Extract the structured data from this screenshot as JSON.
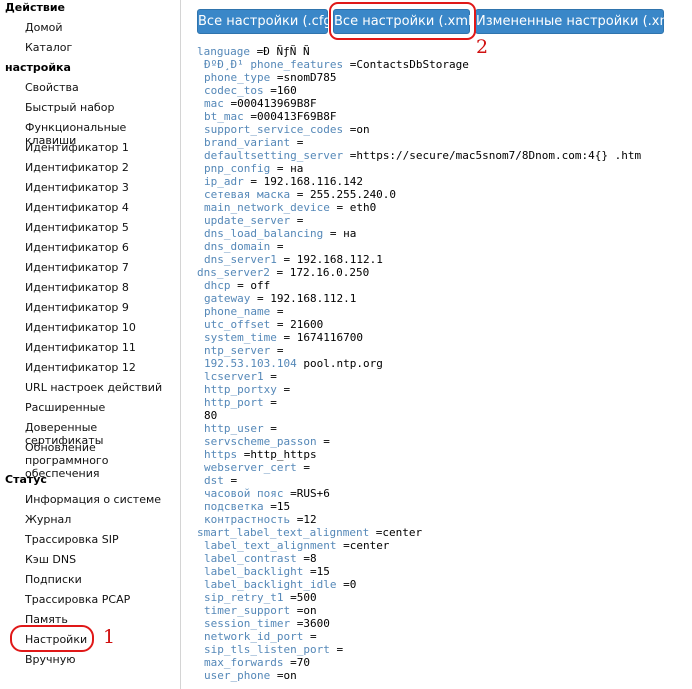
{
  "sidebar": {
    "sections": [
      {
        "title": "Действие",
        "items": [
          "Домой",
          "Каталог"
        ]
      },
      {
        "title": "настройка",
        "items": [
          "Свойства",
          "Быстрый набор",
          "Функциональные клавиши",
          "Идентификатор 1",
          "Идентификатор 2",
          "Идентификатор 3",
          "Идентификатор 4",
          "Идентификатор 5",
          "Идентификатор 6",
          "Идентификатор 7",
          "Идентификатор 8",
          "Идентификатор 9",
          "Идентификатор 10",
          "Идентификатор 11",
          "Идентификатор 12",
          "URL настроек действий",
          "Расширенные",
          "Доверенные сертификаты",
          "Обновление программного обеспечения"
        ]
      },
      {
        "title": "Статус",
        "items": [
          "Информация о системе",
          "Журнал",
          "Трассировка SIP",
          "Кэш DNS",
          "Подписки",
          "Трассировка PCAP",
          "Память",
          "Настройки",
          "Вручную"
        ]
      }
    ]
  },
  "toolbar": {
    "buttons": [
      "Все настройки (.cfg)",
      "Все настройки (.xml)",
      "Измененные настройки (.xml)"
    ]
  },
  "annotations": {
    "marker_1": "1",
    "marker_2": "2",
    "color": "#e01818"
  },
  "config_lines": [
    {
      "key": "language",
      "value": " =Ð ÑƒÑ Ñ",
      "indent": false
    },
    {
      "key": "ÐºÐ¸Ð¹ phone_features",
      "value": " =ContactsDbStorage",
      "indent": true
    },
    {
      "key": "phone_type",
      "value": " =snomD785",
      "indent": true
    },
    {
      "key": "codec_tos",
      "value": " =160",
      "indent": true
    },
    {
      "key": "mac",
      "value": " =000413969B8F",
      "indent": true
    },
    {
      "key": "bt_mac",
      "value": " =000413F69B8F",
      "indent": true
    },
    {
      "key": "support_service_codes",
      "value": " =on",
      "indent": true
    },
    {
      "key": "brand_variant",
      "value": " =",
      "indent": true
    },
    {
      "key": "defaultsetting_server",
      "value": " =https://secure/mac5snom7/8Dnom.com:4{} .htm",
      "indent": true
    },
    {
      "key": "pnp_config",
      "value": " = на",
      "indent": true
    },
    {
      "key": "ip_adr",
      "value": " = 192.168.116.142",
      "indent": true
    },
    {
      "key": "сетевая маска",
      "value": " = 255.255.240.0",
      "indent": true
    },
    {
      "key": "main_network_device",
      "value": " = eth0",
      "indent": true
    },
    {
      "key": "update_server",
      "value": " =",
      "indent": true
    },
    {
      "key": "dns_load_balancing",
      "value": " = на",
      "indent": true
    },
    {
      "key": "dns_domain",
      "value": " =",
      "indent": true
    },
    {
      "key": "dns_server1",
      "value": " = 192.168.112.1",
      "indent": true
    },
    {
      "key": "dns_server2",
      "value": " = 172.16.0.250",
      "indent": false
    },
    {
      "key": "dhcp",
      "value": " = off",
      "indent": true
    },
    {
      "key": "gateway",
      "value": " = 192.168.112.1",
      "indent": true
    },
    {
      "key": "phone_name",
      "value": " =",
      "indent": true
    },
    {
      "key": "utc_offset",
      "value": " = 21600",
      "indent": true
    },
    {
      "key": "system_time",
      "value": " = 1674116700",
      "indent": true
    },
    {
      "key": "ntp_server",
      "value": " =",
      "indent": true
    },
    {
      "key": "192.53.103.104",
      "value": " pool.ntp.org",
      "indent": true
    },
    {
      "key": "lcserver1",
      "value": " =",
      "indent": true
    },
    {
      "key": "http_portxy",
      "value": " =",
      "indent": true
    },
    {
      "key": "http_port",
      "value": " =",
      "indent": true
    },
    {
      "key": "",
      "value": "80",
      "indent": true
    },
    {
      "key": "http_user",
      "value": " =",
      "indent": true
    },
    {
      "key": "servscheme_passon",
      "value": " =",
      "indent": true
    },
    {
      "key": "https",
      "value": " =http_https",
      "indent": true
    },
    {
      "key": "webserver_cert",
      "value": " =",
      "indent": true
    },
    {
      "key": "dst",
      "value": " =",
      "indent": true
    },
    {
      "key": "часовой пояс",
      "value": " =RUS+6",
      "indent": true
    },
    {
      "key": "подсветка",
      "value": " =15",
      "indent": true
    },
    {
      "key": "контрастность",
      "value": " =12",
      "indent": true
    },
    {
      "key": "smart_label_text_alignment",
      "value": " =center",
      "indent": false
    },
    {
      "key": "label_text_alignment",
      "value": " =center",
      "indent": true
    },
    {
      "key": "label_contrast",
      "value": " =8",
      "indent": true
    },
    {
      "key": "label_backlight",
      "value": " =15",
      "indent": true
    },
    {
      "key": "label_backlight_idle",
      "value": " =0",
      "indent": true
    },
    {
      "key": "sip_retry_t1",
      "value": " =500",
      "indent": true
    },
    {
      "key": "timer_support",
      "value": " =on",
      "indent": true
    },
    {
      "key": "session_timer",
      "value": " =3600",
      "indent": true
    },
    {
      "key": "network_id_port",
      "value": " =",
      "indent": true
    },
    {
      "key": "sip_tls_listen_port",
      "value": " =",
      "indent": true
    },
    {
      "key": "max_forwards",
      "value": " =70",
      "indent": true
    },
    {
      "key": "user_phone",
      "value": " =on",
      "indent": true
    }
  ]
}
